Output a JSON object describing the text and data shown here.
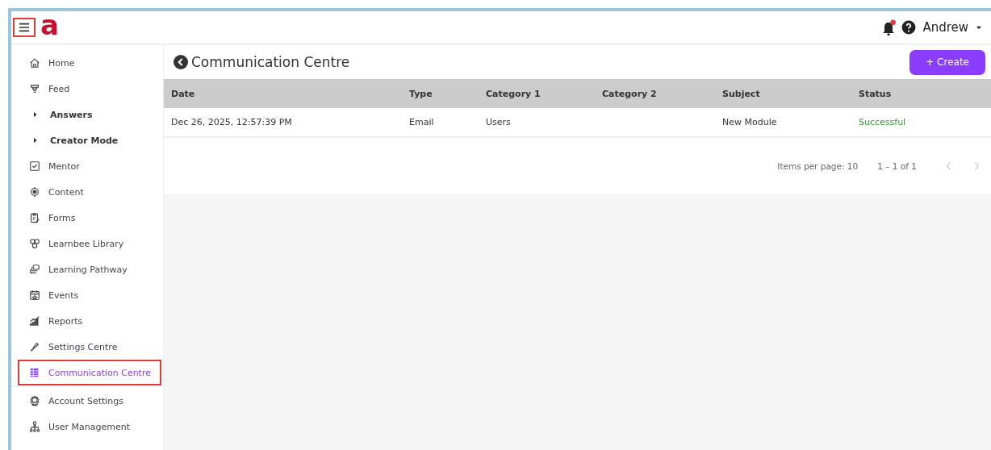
{
  "topbar": {
    "menu_highlighted": true,
    "logo": "a",
    "notification_unread": true,
    "user": "Andrew"
  },
  "sidebar": {
    "items": [
      {
        "label": "Home",
        "kind": "link",
        "selected": false,
        "highlighted": false
      },
      {
        "label": "Feed",
        "kind": "link",
        "selected": false,
        "highlighted": false
      },
      {
        "label": "Answers",
        "kind": "group",
        "selected": false,
        "highlighted": false
      },
      {
        "label": "Creator Mode",
        "kind": "group",
        "selected": false,
        "highlighted": false
      },
      {
        "label": "Mentor",
        "kind": "link",
        "selected": false,
        "highlighted": false
      },
      {
        "label": "Content",
        "kind": "link",
        "selected": false,
        "highlighted": false
      },
      {
        "label": "Forms",
        "kind": "link",
        "selected": false,
        "highlighted": false
      },
      {
        "label": "Learnbee Library",
        "kind": "link",
        "selected": false,
        "highlighted": false
      },
      {
        "label": "Learning Pathway",
        "kind": "link",
        "selected": false,
        "highlighted": false
      },
      {
        "label": "Events",
        "kind": "link",
        "selected": false,
        "highlighted": false
      },
      {
        "label": "Reports",
        "kind": "link",
        "selected": false,
        "highlighted": false
      },
      {
        "label": "Settings Centre",
        "kind": "link",
        "selected": false,
        "highlighted": false
      },
      {
        "label": "Communication Centre",
        "kind": "link",
        "selected": true,
        "highlighted": true
      },
      {
        "label": "Account Settings",
        "kind": "link",
        "selected": false,
        "highlighted": false
      },
      {
        "label": "User Management",
        "kind": "link",
        "selected": false,
        "highlighted": false
      }
    ]
  },
  "page": {
    "title": "Communication Centre",
    "create_button": "+ Create"
  },
  "table": {
    "columns": [
      "Date",
      "Type",
      "Category 1",
      "Category 2",
      "Subject",
      "Status"
    ],
    "rows": [
      {
        "cells": [
          "Dec 26, 2025, 12:57:39 PM",
          "Email",
          "Users",
          "",
          "New Module",
          "Successful"
        ],
        "color": "#2e9e2e"
      }
    ]
  },
  "paginator": {
    "items_per_page": "Items per page: 10",
    "range": "1 – 1 of 1"
  }
}
